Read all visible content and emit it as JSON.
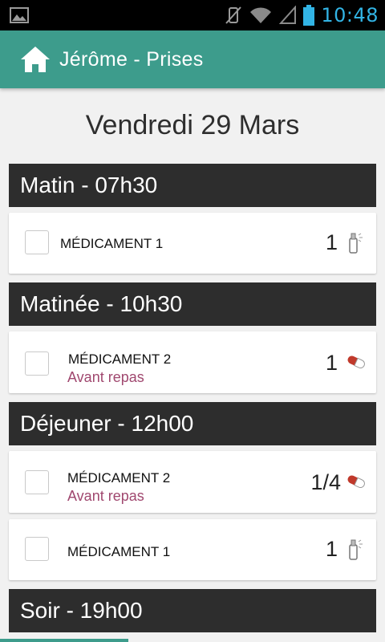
{
  "status_bar": {
    "time": "10:48"
  },
  "app_bar": {
    "title": "Jérôme - Prises"
  },
  "date": "Vendredi 29 Mars",
  "sections": [
    {
      "title": "Matin - 07h30",
      "items": [
        {
          "name": "MÉDICAMENT 1",
          "quantity": "1",
          "icon": "inhaler-icon"
        }
      ]
    },
    {
      "title": "Matinée - 10h30",
      "items": [
        {
          "name": "MÉDICAMENT 2",
          "note": "Avant repas",
          "quantity": "1",
          "icon": "pill-capsule-icon"
        }
      ]
    },
    {
      "title": "Déjeuner - 12h00",
      "items": [
        {
          "name": "MÉDICAMENT 2",
          "note": "Avant repas",
          "quantity": "1/4",
          "icon": "pill-capsule-icon"
        },
        {
          "name": "MÉDICAMENT 1",
          "quantity": "1",
          "icon": "inhaler-icon"
        }
      ]
    },
    {
      "title": "Soir - 19h00",
      "items": []
    }
  ],
  "colors": {
    "app_bar": "#3d9c8c",
    "section_header": "#2d2d2d",
    "note": "#a0486f",
    "status_time": "#32b4e5"
  }
}
